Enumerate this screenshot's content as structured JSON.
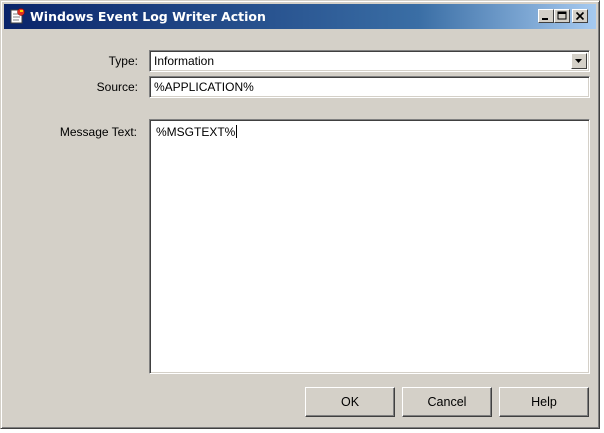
{
  "window": {
    "title": "Windows Event Log Writer Action",
    "controls": [
      "minimize-icon",
      "maximize-icon",
      "close-icon"
    ]
  },
  "form": {
    "type_label": "Type:",
    "type_value": "Information",
    "source_label": "Source:",
    "source_value": "%APPLICATION%",
    "message_label": "Message Text:",
    "message_value": "%MSGTEXT%"
  },
  "buttons": {
    "ok": "OK",
    "cancel": "Cancel",
    "help": "Help"
  },
  "colors": {
    "title_bar_start": "#0a246a",
    "title_bar_end": "#a6caf0",
    "face": "#d4d0c8"
  }
}
